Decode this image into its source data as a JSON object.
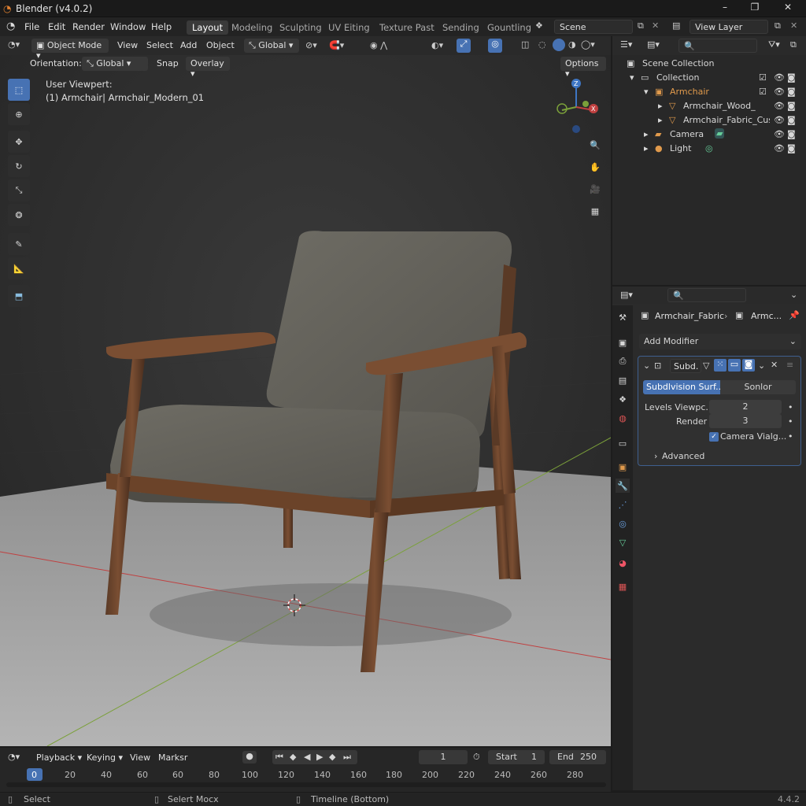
{
  "window": {
    "title": "Blender (v4.0.2)",
    "min": "–",
    "max": "❐",
    "close": "✕"
  },
  "menubar": {
    "menus": [
      "File",
      "Edit",
      "Render",
      "Window",
      "Help"
    ],
    "workspaces": [
      "Layout",
      "Modeling",
      "Sculpting",
      "UV Eiting",
      "Texture Past",
      "Sending",
      "Gountling"
    ],
    "scene": "Scene",
    "view_layer": "View Layer"
  },
  "viewport_header": {
    "mode": "Object Mode",
    "menus": [
      "View",
      "Select",
      "Add",
      "Object"
    ],
    "transform": "Global",
    "orientation_label": "Orientation:",
    "orientation_value": "Global",
    "snap": "Snap",
    "overlay": "Overlay",
    "options": "Options"
  },
  "viewport": {
    "view_name": "User Viewpert:",
    "object_info": "(1) Armchair| Armchair_Modern_01"
  },
  "outliner": {
    "items": [
      {
        "label": "Scene Collection"
      },
      {
        "label": "Collection"
      },
      {
        "label": "Armchair"
      },
      {
        "label": "Armchair_Wood_Frame"
      },
      {
        "label": "Armchair_Fabric_Cush"
      },
      {
        "label": "Camera"
      },
      {
        "label": "Light"
      }
    ]
  },
  "properties": {
    "breadcrumb_object": "Armchair_Fabric",
    "breadcrumb_mesh": "Armc...",
    "add_modifier": "Add Modifier",
    "modifier": {
      "name": "Subd.",
      "type_a": "Subdlvision Surf...",
      "type_b": "Sonlor",
      "levels_label": "Levels Viewpc.",
      "levels_value": "2",
      "render_label": "Render",
      "render_value": "3",
      "camera_label": "Camera Vialg...",
      "advanced": "Advanced"
    }
  },
  "timeline": {
    "menus": [
      "Playback",
      "Keying",
      "View",
      "Marksr"
    ],
    "current_frame": "1",
    "start_label": "Start",
    "start_value": "1",
    "end_label": "End",
    "end_value": "250",
    "ticks": [
      "0",
      "20",
      "40",
      "60",
      "60",
      "80",
      "100",
      "120",
      "140",
      "160",
      "180",
      "200",
      "220",
      "240",
      "260",
      "280"
    ]
  },
  "statusbar": {
    "select": "Select",
    "select_mode": "Selert Mocx",
    "timeline": "Timeline (Bottom)",
    "version": "4.4.2"
  },
  "colors": {
    "accent": "#4772b3",
    "object_orange": "#e09a4c",
    "axis_x": "#c04040",
    "axis_y": "#7ba03a",
    "axis_z": "#3e76c4"
  }
}
